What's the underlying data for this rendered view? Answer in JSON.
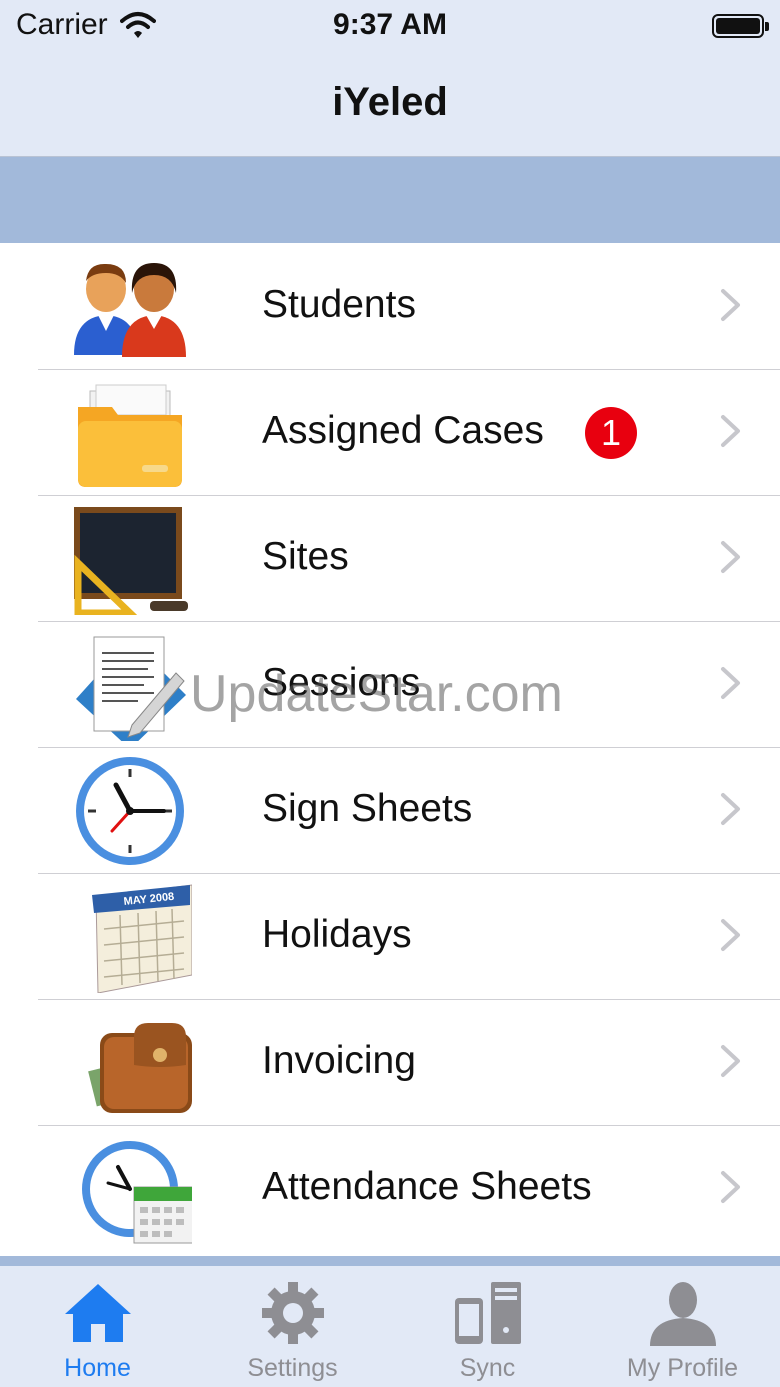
{
  "status_bar": {
    "carrier": "Carrier",
    "time": "9:37 AM"
  },
  "nav": {
    "title": "iYeled"
  },
  "menu": {
    "items": [
      {
        "label": "Students",
        "icon": "students-icon"
      },
      {
        "label": "Assigned Cases",
        "icon": "folder-icon",
        "badge": "1"
      },
      {
        "label": "Sites",
        "icon": "chalkboard-icon"
      },
      {
        "label": "Sessions",
        "icon": "document-pen-icon"
      },
      {
        "label": "Sign Sheets",
        "icon": "clock-icon"
      },
      {
        "label": "Holidays",
        "icon": "calendar-icon",
        "calendar_text": "MAY 2008"
      },
      {
        "label": "Invoicing",
        "icon": "wallet-icon"
      },
      {
        "label": "Attendance Sheets",
        "icon": "clock-calendar-icon"
      }
    ]
  },
  "watermark": "UpdateStar.com",
  "tabs": [
    {
      "label": "Home",
      "icon": "home-icon",
      "active": true
    },
    {
      "label": "Settings",
      "icon": "gear-icon",
      "active": false
    },
    {
      "label": "Sync",
      "icon": "sync-devices-icon",
      "active": false
    },
    {
      "label": "My Profile",
      "icon": "profile-icon",
      "active": false
    }
  ],
  "colors": {
    "accent": "#1e7cf0",
    "badge": "#e8000f",
    "band": "#a2b9da",
    "bar": "#e2e9f6"
  }
}
